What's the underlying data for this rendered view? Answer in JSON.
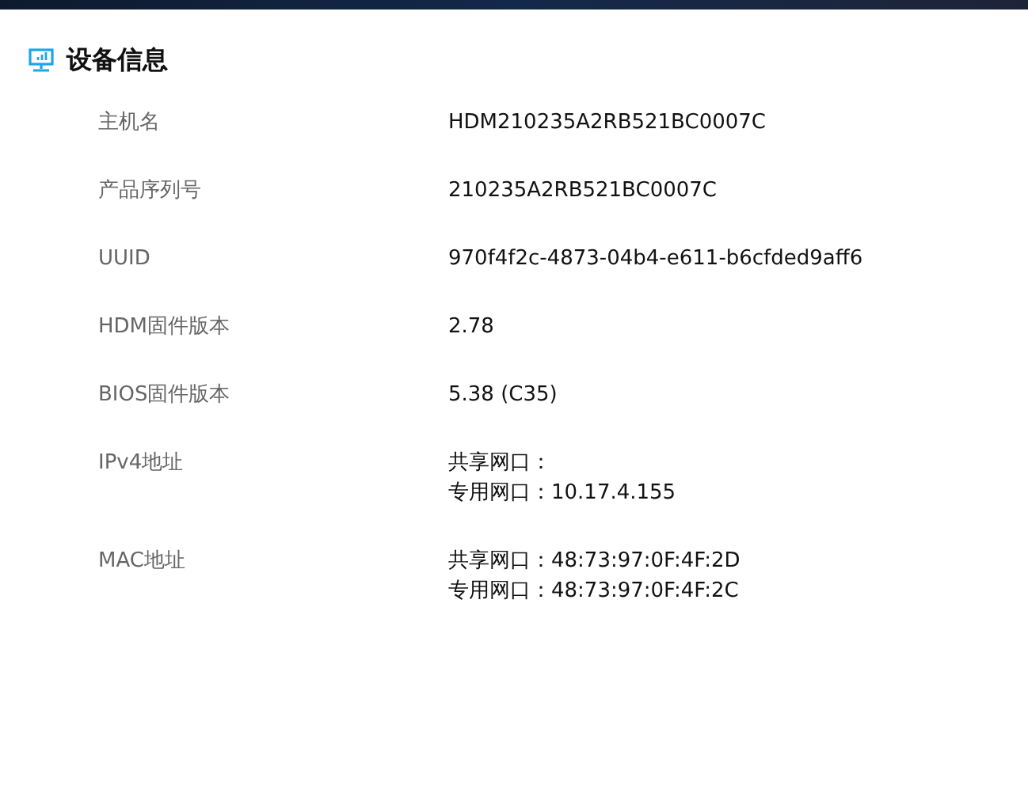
{
  "title": "设备信息",
  "rows": [
    {
      "label": "主机名",
      "lines": [
        "HDM210235A2RB521BC0007C"
      ]
    },
    {
      "label": "产品序列号",
      "lines": [
        "210235A2RB521BC0007C"
      ]
    },
    {
      "label": "UUID",
      "lines": [
        "970f4f2c-4873-04b4-e611-b6cfded9aff6"
      ]
    },
    {
      "label": "HDM固件版本",
      "lines": [
        "2.78"
      ]
    },
    {
      "label": "BIOS固件版本",
      "lines": [
        "5.38 (C35)"
      ]
    },
    {
      "label": "IPv4地址",
      "lines": [
        "共享网口：",
        "专用网口：10.17.4.155"
      ]
    },
    {
      "label": "MAC地址",
      "lines": [
        "共享网口：48:73:97:0F:4F:2D",
        "专用网口：48:73:97:0F:4F:2C"
      ]
    }
  ]
}
